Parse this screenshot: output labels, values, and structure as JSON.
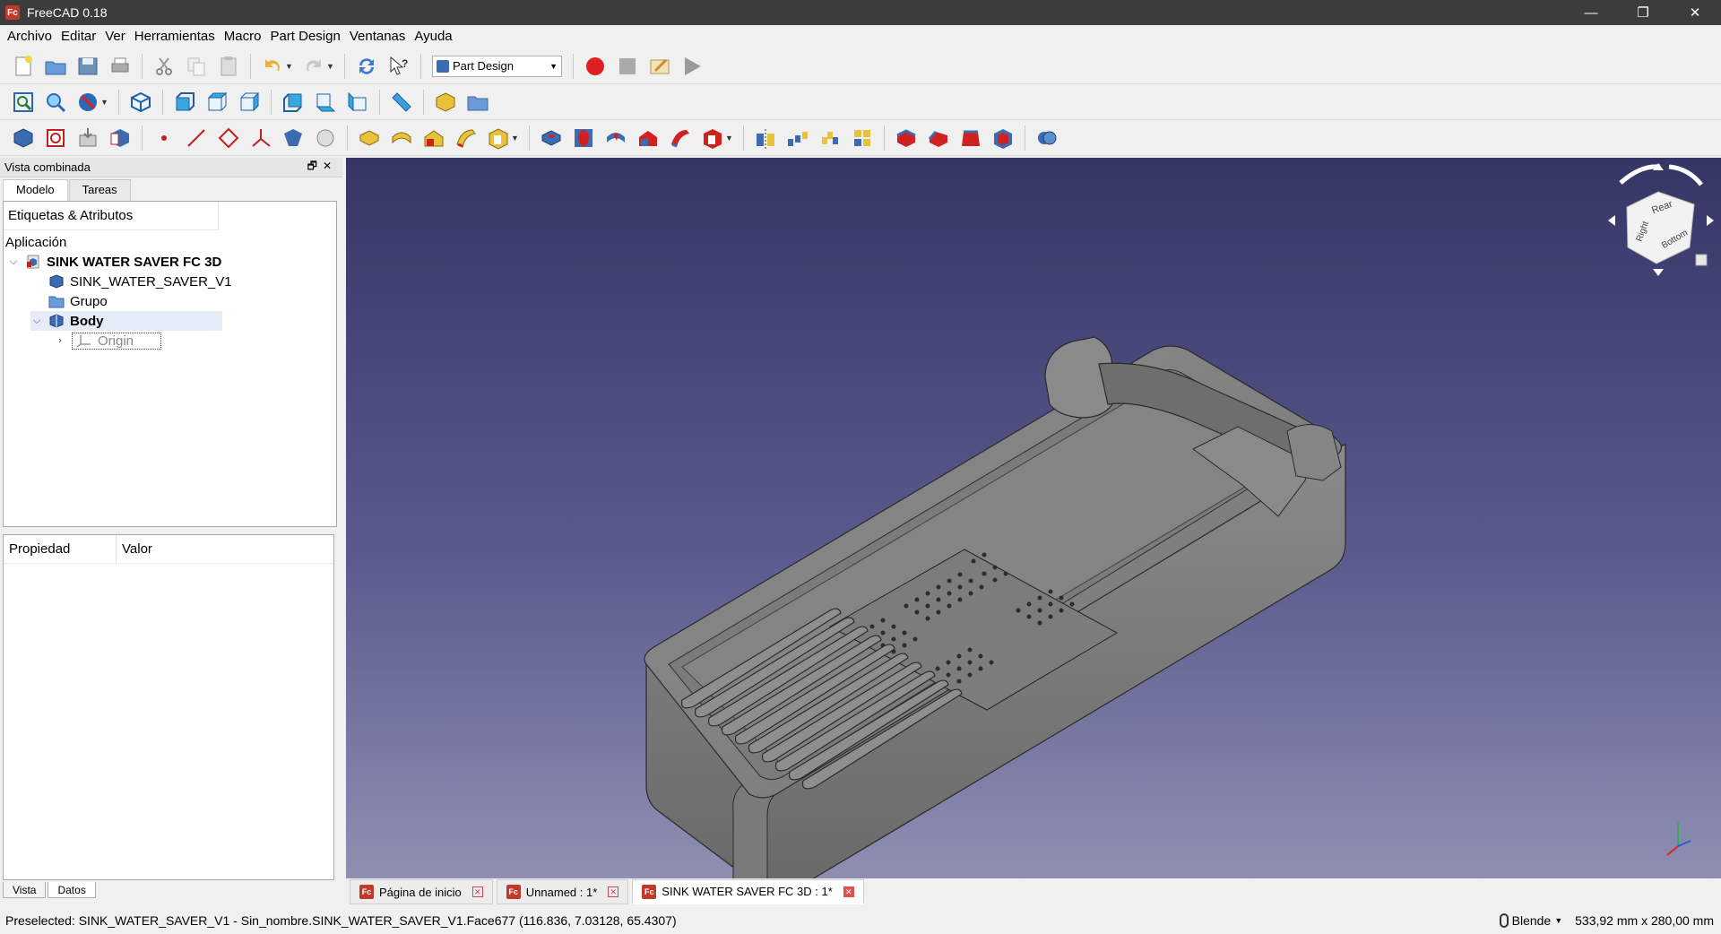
{
  "window": {
    "title": "FreeCAD 0.18",
    "app_icon_glyph": "Fc",
    "minimize_glyph": "—",
    "maximize_glyph": "❐",
    "close_glyph": "✕"
  },
  "menu": [
    "Archivo",
    "Editar",
    "Ver",
    "Herramientas",
    "Macro",
    "Part Design",
    "Ventanas",
    "Ayuda"
  ],
  "toolbar": {
    "workbench": "Part Design"
  },
  "combo_view": {
    "title": "Vista combinada",
    "controls": "🗗✕",
    "tabs": [
      "Modelo",
      "Tareas"
    ],
    "tree_header": "Etiquetas & Atributos",
    "application_label": "Aplicación",
    "document": "SINK WATER SAVER FC 3D",
    "items": {
      "solid": "SINK_WATER_SAVER_V1",
      "group": "Grupo",
      "body": "Body",
      "origin": "Origin"
    },
    "property_columns": [
      "Propiedad",
      "Valor"
    ],
    "bottom_tabs": [
      "Vista",
      "Datos"
    ]
  },
  "navcube": {
    "faces": [
      "Rear",
      "Right",
      "Bottom"
    ]
  },
  "document_tabs": [
    {
      "label": "Página de inicio",
      "active": false
    },
    {
      "label": "Unnamed : 1*",
      "active": false
    },
    {
      "label": "SINK WATER SAVER FC 3D : 1*",
      "active": true
    }
  ],
  "status": {
    "message": "Preselected: SINK_WATER_SAVER_V1 - Sin_nombre.SINK_WATER_SAVER_V1.Face677 (116.836, 7.03128, 65.4307)",
    "navigation_style": "Blende",
    "dimensions": "533,92 mm x 280,00 mm"
  },
  "colors": {
    "model_gray": "#7d7d7d",
    "viewport_top": "#353566",
    "viewport_bottom": "#8f8fb3",
    "record_red": "#e02020"
  }
}
